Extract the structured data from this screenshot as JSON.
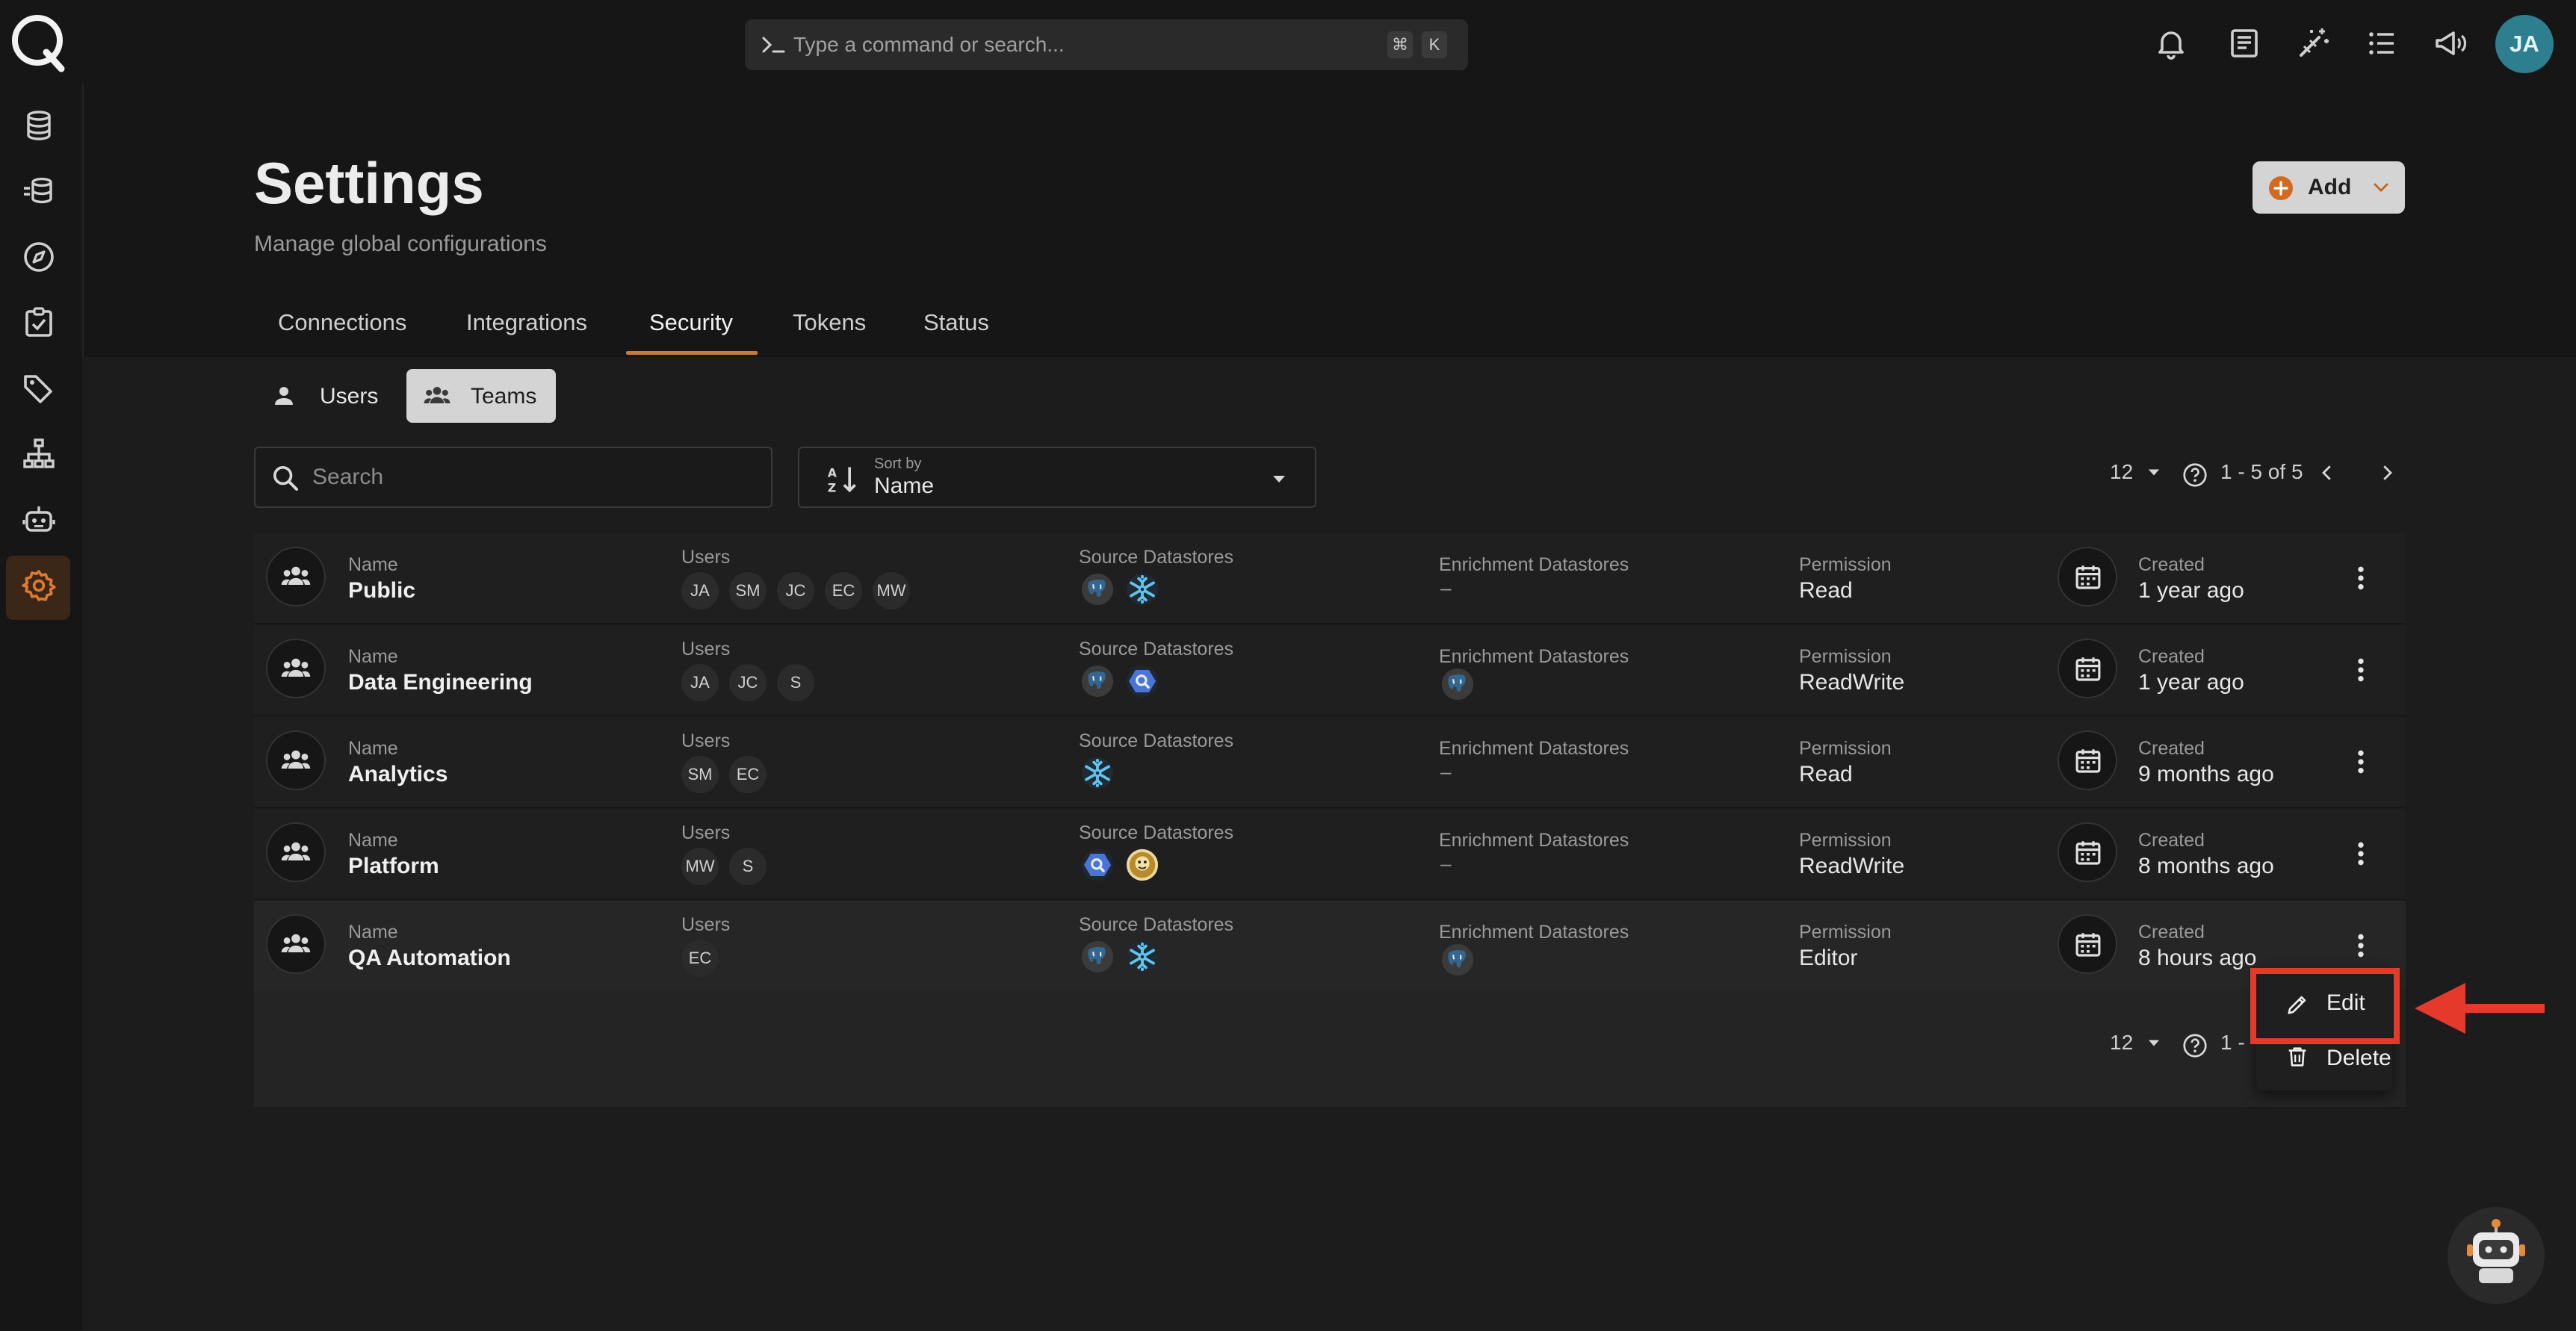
{
  "colors": {
    "accent": "#c87a3a",
    "arrow": "#e53a2b",
    "avatar": "#2d7f8f"
  },
  "topbar": {
    "command_placeholder": "Type a command or search...",
    "shortcut_keys": [
      "⌘",
      "K"
    ],
    "icons": [
      "bell-icon",
      "document-icon",
      "magic-wand-icon",
      "list-icon",
      "megaphone-icon"
    ],
    "avatar_initials": "JA"
  },
  "sidebar": {
    "icons": [
      "database-icon",
      "datastore-flow-icon",
      "compass-icon",
      "checklist-icon",
      "tag-icon",
      "hierarchy-icon",
      "robot-icon",
      "gear-icon"
    ],
    "active": "gear-icon"
  },
  "header": {
    "title": "Settings",
    "subtitle": "Manage global configurations",
    "add_label": "Add"
  },
  "tabs": [
    {
      "label": "Connections"
    },
    {
      "label": "Integrations"
    },
    {
      "label": "Security",
      "active": true
    },
    {
      "label": "Tokens"
    },
    {
      "label": "Status"
    }
  ],
  "subtabs": {
    "users": "Users",
    "teams": "Teams",
    "active": "Teams"
  },
  "search": {
    "placeholder": "Search"
  },
  "sort": {
    "caption": "Sort by",
    "value": "Name"
  },
  "pagination": {
    "page_size": "12",
    "range": "1 - 5 of 5",
    "bottom_range_partial": "1 -"
  },
  "columns": {
    "name": "Name",
    "users": "Users",
    "source": "Source Datastores",
    "enrichment": "Enrichment Datastores",
    "permission": "Permission",
    "created": "Created"
  },
  "teams": [
    {
      "name": "Public",
      "users": [
        "JA",
        "SM",
        "JC",
        "EC",
        "MW"
      ],
      "source": [
        "postgres-icon",
        "snowflake-icon"
      ],
      "enrichment": [],
      "enrichment_empty": "–",
      "permission": "Read",
      "created": "1 year ago"
    },
    {
      "name": "Data Engineering",
      "users": [
        "JA",
        "JC",
        "S"
      ],
      "source": [
        "postgres-icon",
        "bigquery-icon"
      ],
      "enrichment": [
        "postgres-icon"
      ],
      "enrichment_empty": "",
      "permission": "ReadWrite",
      "created": "1 year ago"
    },
    {
      "name": "Analytics",
      "users": [
        "SM",
        "EC"
      ],
      "source": [
        "snowflake-icon"
      ],
      "enrichment": [],
      "enrichment_empty": "–",
      "permission": "Read",
      "created": "9 months ago"
    },
    {
      "name": "Platform",
      "users": [
        "MW",
        "S"
      ],
      "source": [
        "bigquery-icon",
        "hive-icon"
      ],
      "enrichment": [],
      "enrichment_empty": "–",
      "permission": "ReadWrite",
      "created": "8 months ago"
    },
    {
      "name": "QA Automation",
      "users": [
        "EC"
      ],
      "source": [
        "postgres-icon",
        "snowflake-icon"
      ],
      "enrichment": [
        "postgres-icon"
      ],
      "enrichment_empty": "",
      "permission": "Editor",
      "created": "8 hours ago"
    }
  ],
  "menu": {
    "edit": "Edit",
    "delete": "Delete"
  }
}
